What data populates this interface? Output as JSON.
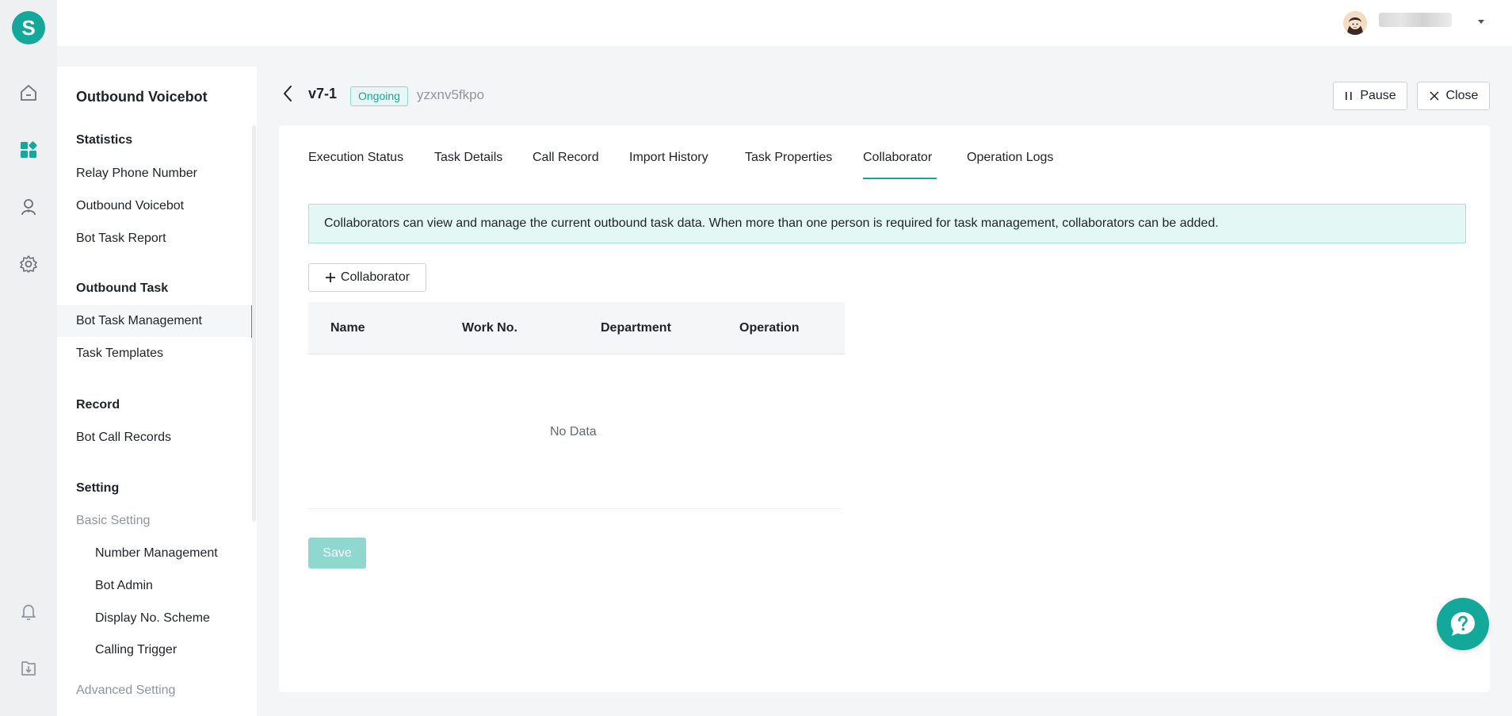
{
  "app": {
    "logo_letter": "S",
    "accent_color": "#14a89a"
  },
  "rail": {
    "icons": [
      "home-icon",
      "apps-icon",
      "contact-icon",
      "settings-icon",
      "bell-icon",
      "download-icon"
    ]
  },
  "sidebar": {
    "title": "Outbound Voicebot",
    "groups": {
      "statistics": "Statistics",
      "outbound_task": "Outbound Task",
      "record": "Record",
      "setting": "Setting"
    },
    "items": {
      "relay_phone_number": "Relay Phone Number",
      "outbound_voicebot": "Outbound Voicebot",
      "bot_task_report": "Bot Task Report",
      "bot_task_management": "Bot Task Management",
      "task_templates": "Task Templates",
      "bot_call_records": "Bot Call Records",
      "basic_setting": "Basic Setting",
      "number_management": "Number Management",
      "bot_admin": "Bot Admin",
      "display_no_scheme": "Display No. Scheme",
      "calling_trigger": "Calling Trigger",
      "advanced_setting": "Advanced Setting"
    },
    "active_item": "Bot Task Management"
  },
  "header": {
    "task_name": "v7-1",
    "status": "Ongoing",
    "task_code": "yzxnv5fkpo",
    "pause_label": "Pause",
    "close_label": "Close"
  },
  "tabs": {
    "execution_status": "Execution Status",
    "task_details": "Task Details",
    "call_record": "Call Record",
    "import_history": "Import History",
    "task_properties": "Task Properties",
    "collaborator": "Collaborator",
    "operation_logs": "Operation Logs",
    "active": "Collaborator"
  },
  "collaborator": {
    "notice": "Collaborators can view and manage the current outbound task data. When more than one person is required for task management, collaborators can be added.",
    "add_label": "Collaborator",
    "columns": {
      "name": "Name",
      "work_no": "Work No.",
      "department": "Department",
      "operation": "Operation"
    },
    "empty_text": "No Data",
    "save_label": "Save"
  },
  "help": {
    "icon": "help-chat-icon"
  }
}
